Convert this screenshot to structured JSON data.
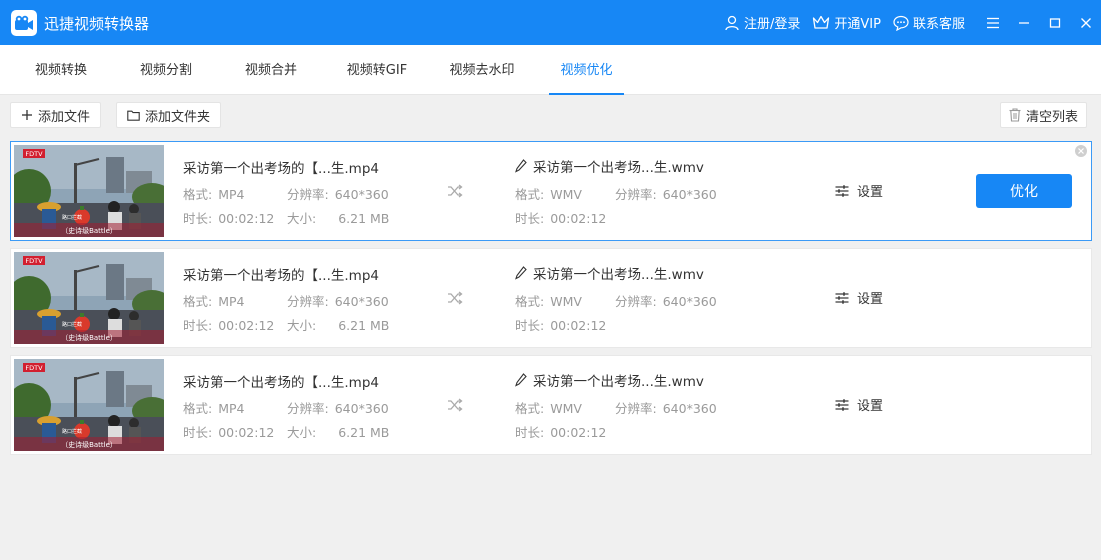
{
  "app": {
    "title": "迅捷视频转换器",
    "login": "注册/登录",
    "vip": "开通VIP",
    "support": "联系客服"
  },
  "tabs": [
    {
      "label": "视频转换"
    },
    {
      "label": "视频分割"
    },
    {
      "label": "视频合并"
    },
    {
      "label": "视频转GIF"
    },
    {
      "label": "视频去水印"
    },
    {
      "label": "视频优化"
    }
  ],
  "active_tab": "视频优化",
  "toolbar": {
    "add_file": "添加文件",
    "add_folder": "添加文件夹",
    "clear_list": "清空列表"
  },
  "labels": {
    "format": "格式:",
    "resolution": "分辨率:",
    "duration": "时长:",
    "size": "大小:",
    "settings": "设置",
    "optimize": "优化"
  },
  "thumbnail": {
    "channel": "FDTV",
    "caption": "（史诗级Battle）",
    "sub": "路口拦截"
  },
  "items": [
    {
      "src_name": "采访第一个出考场的【...生.mp4",
      "src_format": "MP4",
      "src_resolution": "640*360",
      "src_duration": "00:02:12",
      "src_size": "6.21 MB",
      "out_name": "采访第一个出考场...生.wmv",
      "out_format": "WMV",
      "out_resolution": "640*360",
      "out_duration": "00:02:12"
    },
    {
      "src_name": "采访第一个出考场的【...生.mp4",
      "src_format": "MP4",
      "src_resolution": "640*360",
      "src_duration": "00:02:12",
      "src_size": "6.21 MB",
      "out_name": "采访第一个出考场...生.wmv",
      "out_format": "WMV",
      "out_resolution": "640*360",
      "out_duration": "00:02:12"
    },
    {
      "src_name": "采访第一个出考场的【...生.mp4",
      "src_format": "MP4",
      "src_resolution": "640*360",
      "src_duration": "00:02:12",
      "src_size": "6.21 MB",
      "out_name": "采访第一个出考场...生.wmv",
      "out_format": "WMV",
      "out_resolution": "640*360",
      "out_duration": "00:02:12"
    }
  ],
  "colors": {
    "accent": "#1787f5",
    "background": "#f0f0f0"
  }
}
